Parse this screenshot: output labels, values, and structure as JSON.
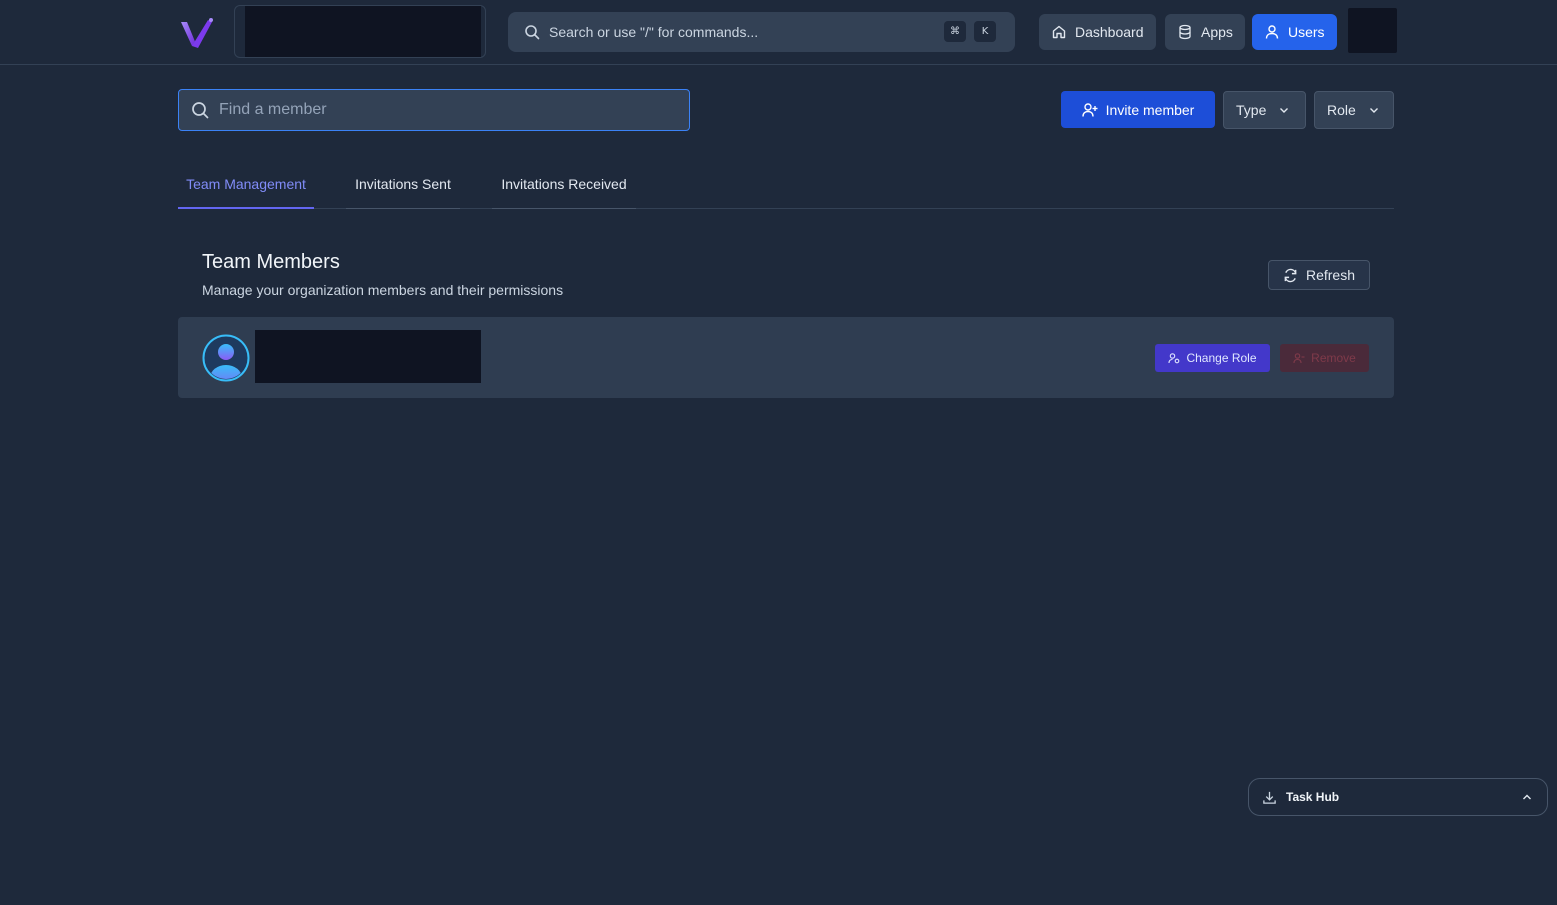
{
  "header": {
    "logo_icon": "v-logo-icon",
    "search": {
      "placeholder": "Search or use \"/\" for commands...",
      "shortcut_keys": [
        "⌘",
        "K"
      ]
    },
    "nav": [
      {
        "label": "Dashboard",
        "icon": "home-icon",
        "active": false
      },
      {
        "label": "Apps",
        "icon": "database-icon",
        "active": false
      },
      {
        "label": "Users",
        "icon": "user-icon",
        "active": true
      }
    ]
  },
  "toolbar": {
    "find_placeholder": "Find a member",
    "invite_label": "Invite member",
    "type_label": "Type",
    "role_label": "Role"
  },
  "tabs": [
    {
      "label": "Team Management",
      "active": true
    },
    {
      "label": "Invitations Sent",
      "active": false
    },
    {
      "label": "Invitations Received",
      "active": false
    }
  ],
  "team": {
    "title": "Team Members",
    "subtitle": "Manage your organization members and their permissions",
    "refresh_label": "Refresh",
    "members": [
      {
        "change_role_label": "Change Role",
        "remove_label": "Remove"
      }
    ]
  },
  "task_hub": {
    "label": "Task Hub"
  },
  "colors": {
    "background": "#1e293b",
    "accent": "#2563eb",
    "tab_active": "#818cf8",
    "change_role": "#4338ca"
  }
}
